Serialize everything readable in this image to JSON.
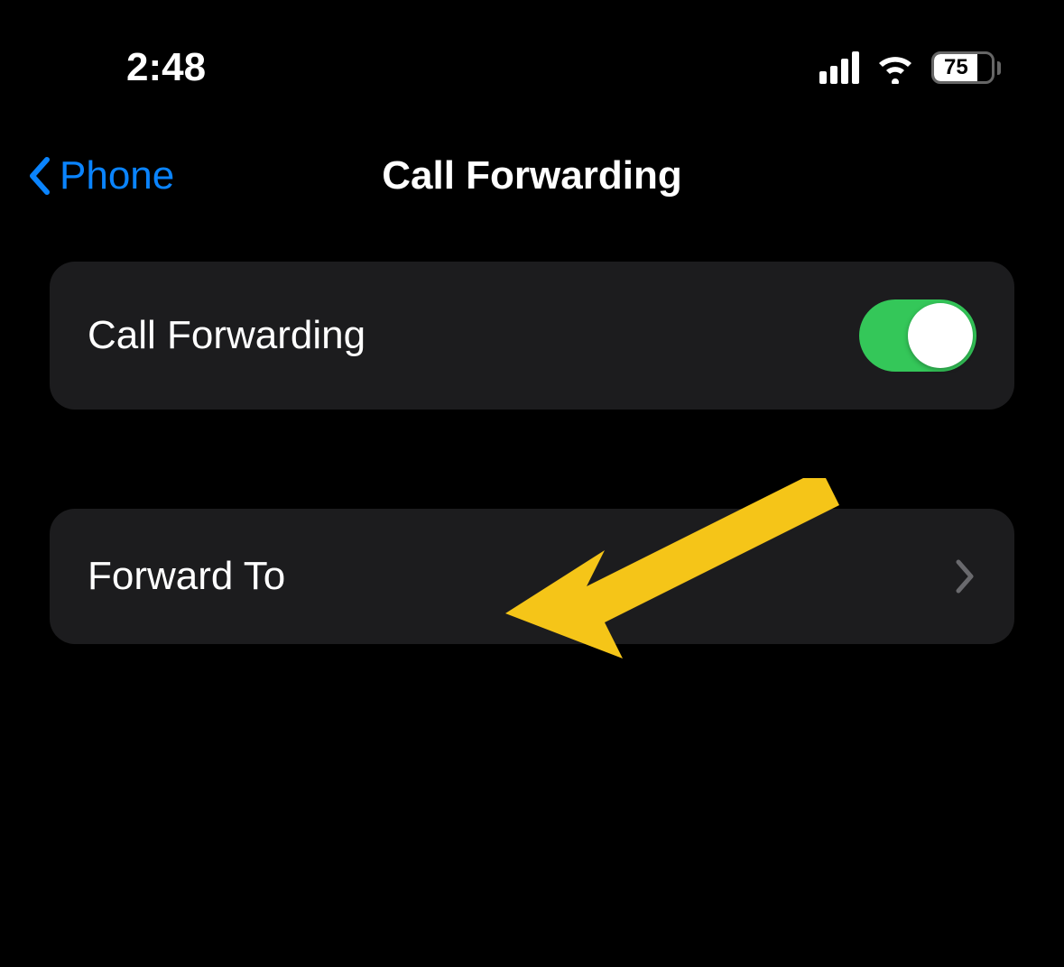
{
  "status_bar": {
    "time": "2:48",
    "battery_percent": "75"
  },
  "nav": {
    "back_label": "Phone",
    "title": "Call Forwarding"
  },
  "settings": {
    "call_forwarding_label": "Call Forwarding",
    "call_forwarding_on": true,
    "forward_to_label": "Forward To"
  },
  "colors": {
    "accent": "#0a84ff",
    "toggle_on": "#34c759",
    "cell_bg": "#1c1c1e",
    "annotation": "#f5c518"
  }
}
